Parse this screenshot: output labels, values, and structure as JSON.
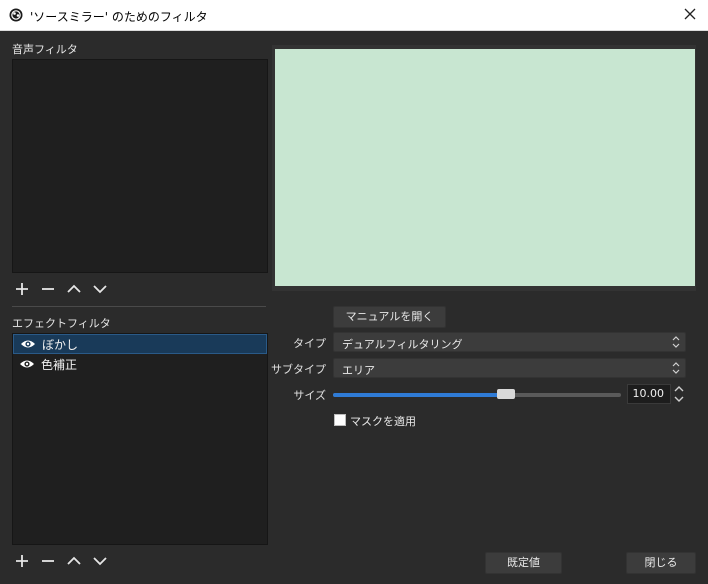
{
  "window": {
    "title": "'ソースミラー' のためのフィルタ",
    "icons": {
      "app": "obs-logo-icon",
      "close": "close-icon"
    }
  },
  "audio_filters": {
    "label": "音声フィルタ",
    "items": [],
    "toolbar": {
      "icons": [
        "plus-icon",
        "minus-icon",
        "chevron-up-icon",
        "chevron-down-icon"
      ]
    }
  },
  "effect_filters": {
    "label": "エフェクトフィルタ",
    "items": [
      {
        "name": "ぼかし",
        "visible": true,
        "selected": true,
        "icon": "eye-icon"
      },
      {
        "name": "色補正",
        "visible": true,
        "selected": false,
        "icon": "eye-icon"
      }
    ],
    "toolbar": {
      "icons": [
        "plus-icon",
        "minus-icon",
        "chevron-up-icon",
        "chevron-down-icon"
      ]
    }
  },
  "preview": {
    "fill_color": "#c8e6d1"
  },
  "properties": {
    "manual_button": "マニュアルを開く",
    "type": {
      "label": "タイプ",
      "value": "デュアルフィルタリング"
    },
    "subtype": {
      "label": "サブタイプ",
      "value": "エリア"
    },
    "size": {
      "label": "サイズ",
      "value": "10.00",
      "slider_fraction": 0.6
    },
    "mask": {
      "label": "マスクを適用",
      "checked": false
    }
  },
  "footer": {
    "defaults_button": "既定値",
    "close_button": "閉じる"
  },
  "colors": {
    "background": "#2b2b2b",
    "panel": "#1f1f1f",
    "selection": "#193a59",
    "accent": "#2f7bd6",
    "button": "#3c3c3c"
  }
}
